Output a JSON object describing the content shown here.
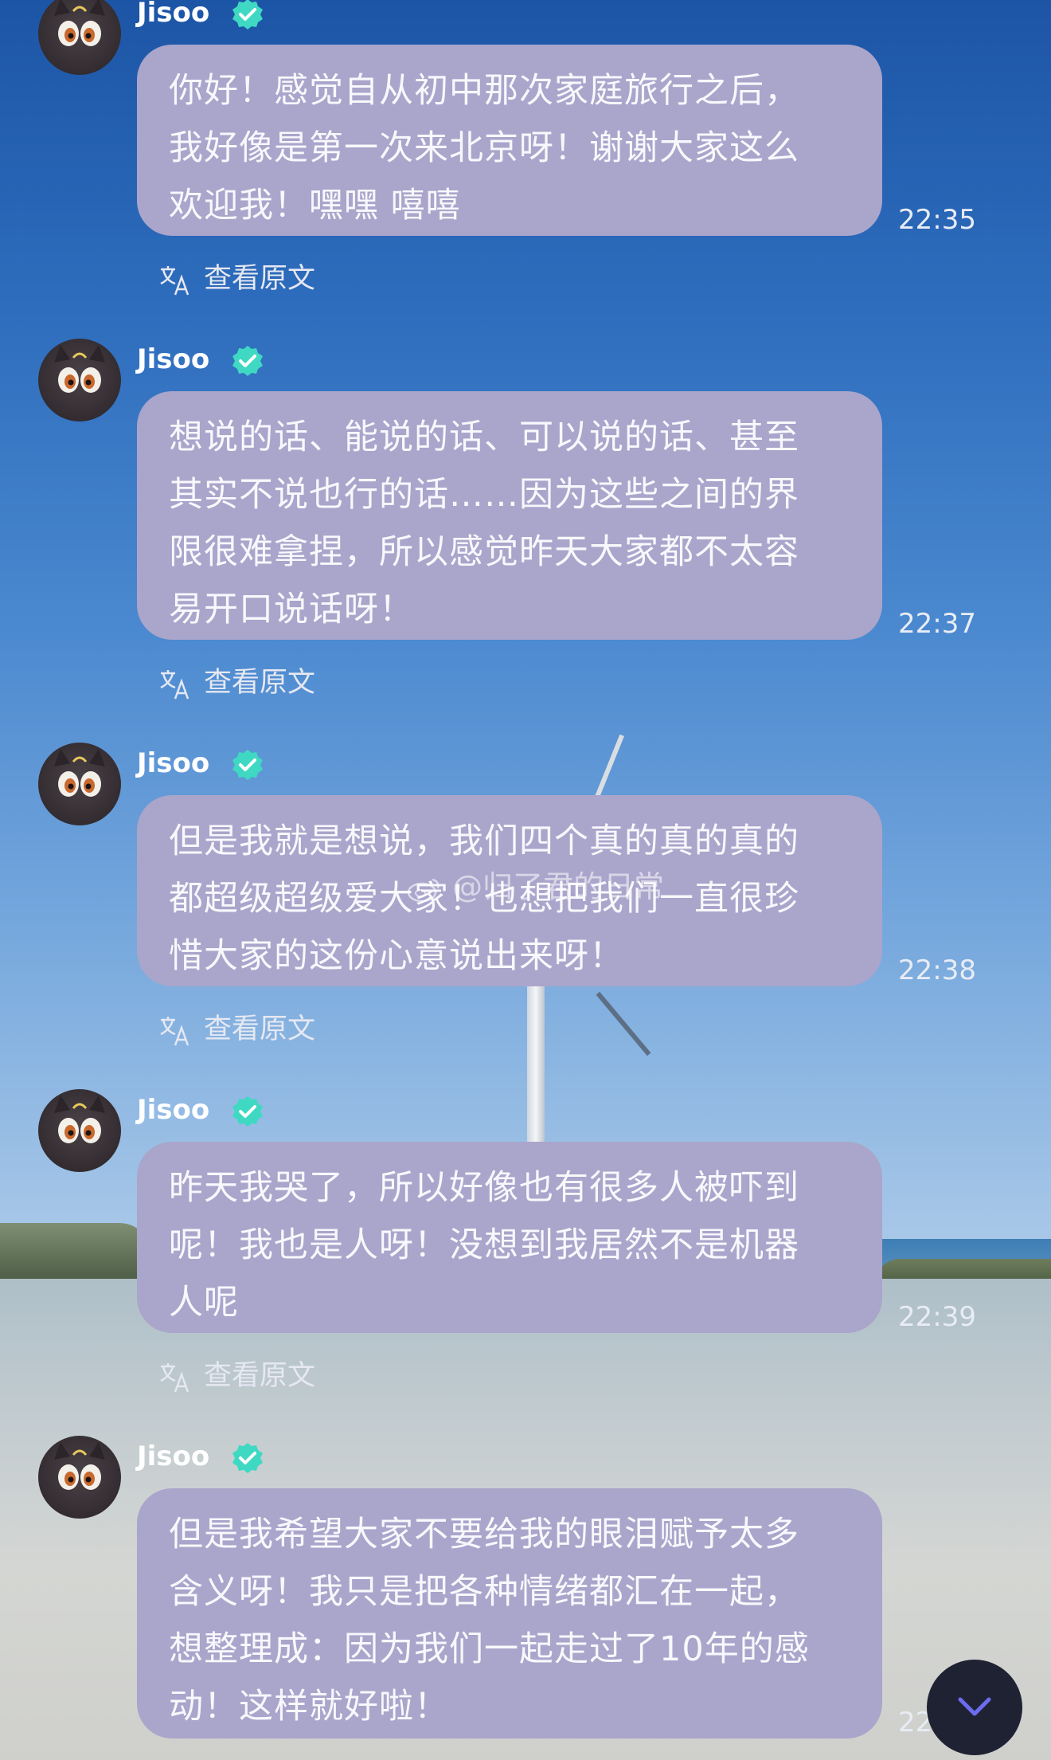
{
  "sender": {
    "name": "Jisoo",
    "verified_icon": "verified-badge-icon",
    "avatar_icon": "cartoon-cat-avatar"
  },
  "translate_label": "查看原文",
  "watermark": "@归了君的日常",
  "messages": [
    {
      "text": "你好！感觉自从初中那次家庭旅行之后，\n我好像是第一次来北京呀！谢谢大家这么\n欢迎我！嘿嘿 嘻嘻",
      "time": "22:35"
    },
    {
      "text": "想说的话、能说的话、可以说的话、甚至\n其实不说也行的话……因为这些之间的界\n限很难拿捏，所以感觉昨天大家都不太容\n易开口说话呀！",
      "time": "22:37"
    },
    {
      "text": "但是我就是想说，我们四个真的真的真的\n都超级超级爱大家！也想把我们一直很珍\n惜大家的这份心意说出来呀！",
      "time": "22:38"
    },
    {
      "text": "昨天我哭了，所以好像也有很多人被吓到\n呢！我也是人呀！没想到我居然不是机器\n人呢",
      "time": "22:39"
    },
    {
      "text": "但是我希望大家不要给我的眼泪赋予太多\n含义呀！我只是把各种情绪都汇在一起，\n想整理成：因为我们一起走过了10年的感\n动！这样就好啦！",
      "time": "22"
    }
  ],
  "scroll_button_icon": "chevron-down-icon",
  "colors": {
    "bubble": "#aaa5cb",
    "badge": "#3fd9c3",
    "scroll_button": "#1f2233",
    "chevron": "#6b6cf0"
  }
}
